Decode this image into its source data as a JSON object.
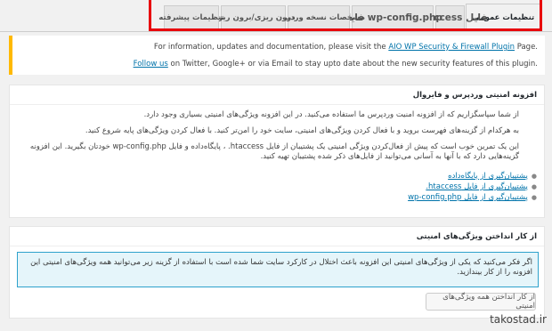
{
  "tabs": [
    {
      "label": "تنظیمات عمومی",
      "active": true
    },
    {
      "label": ".htaccess فایل",
      "active": false
    },
    {
      "label": "wp-config.php فایل",
      "active": false
    },
    {
      "label": "مشخصات نسخه وردپرس",
      "active": false
    },
    {
      "label": "درون ریزی/برون ریزی",
      "active": false
    },
    {
      "label": "تنظیمات پیشرفته",
      "active": false
    }
  ],
  "notice": {
    "line1_text": "For information, updates and documentation, please visit the ",
    "line1_link": "AIO WP Security & Firewall Plugin",
    "line1_end": " Page.",
    "line2_link": "Follow us",
    "line2_text": " on Twitter, Google+ or via Email to stay upto date about the new security features of this plugin."
  },
  "about_box": {
    "title": "افزونه امنیتی وردپرس و فایروال",
    "p1": "از شما سپاسگزاریم که از افزونه امنیت وردپرس ما استفاده می‌کنید. در این افزونه ویژگی‌های امنیتی بسیاری وجود دارد.",
    "p2": "به هرکدام از گزینه‌های فهرست بروید و با فعال کردن ویژگی‌های امنیتی، سایت خود را امن‌تر کنید. با فعال کردن ویژگی‌های پایه شروع کنید.",
    "p3": "این یک تمرین خوب است که پیش از فعال‌کردن ویژگی امنیتی یک پشتیبان از فایل htaccess. ، پایگاه‌داده و فایل wp-config.php خودتان بگیرید. این افزونه گزینه‌هایی دارد که با آنها به آسانی می‌توانید از فایل‌های ذکر شده پشتیبان تهیه کنید.",
    "links": [
      "پشتیبان‌گیری از پایگاه‌داده",
      "پشتیبان‌گیری از فایل htaccess.",
      "پشتیبان‌گیری از فایل wp-config.php"
    ]
  },
  "disable_box": {
    "title": "از کار انداختن ویژگی‌های امنیتی",
    "info": "اگر فکر می‌کنید که یکی از ویژگی‌های امنیتی این افزونه باعث اختلال در کارکرد سایت شما شده است با استفاده از گزینه زیر می‌توانید همه ویژگی‌های امنیتی این افزونه را از کار بیندازید.",
    "button": "از کار انداختن همه ویژگی‌های امنیتی"
  },
  "watermark": "takostad.ir"
}
